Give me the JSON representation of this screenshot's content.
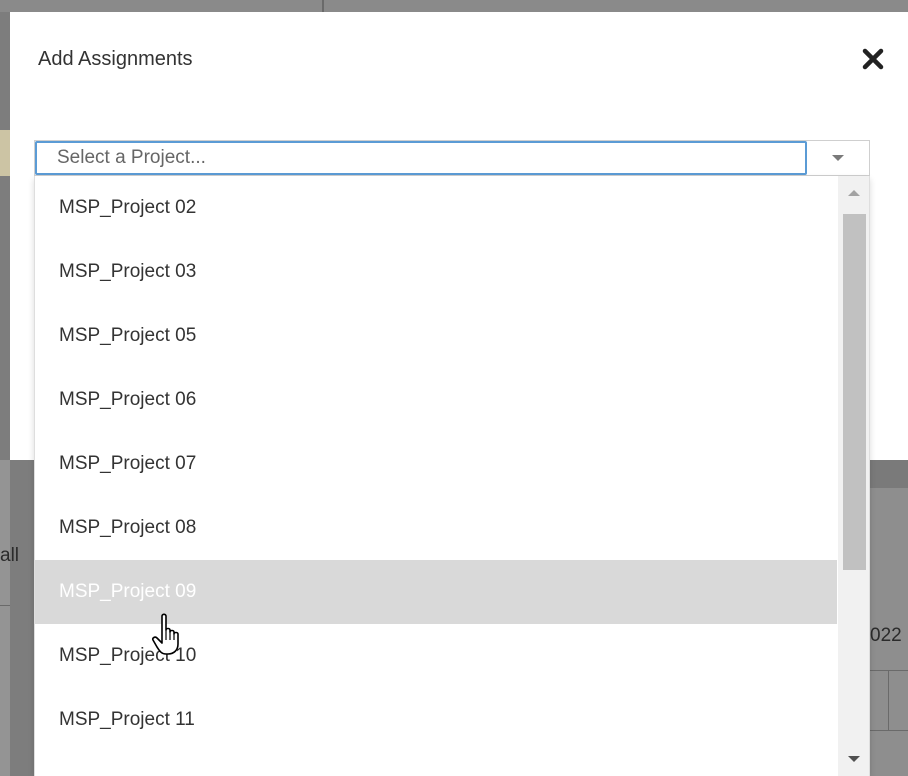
{
  "modal": {
    "title": "Add Assignments",
    "close_icon": "close-icon"
  },
  "project_select": {
    "placeholder": "Select a Project...",
    "value": "",
    "arrow_icon": "chevron-down-icon"
  },
  "dropdown": {
    "items": [
      {
        "label": "MSP_Project 02"
      },
      {
        "label": "MSP_Project 03"
      },
      {
        "label": "MSP_Project 05"
      },
      {
        "label": "MSP_Project 06"
      },
      {
        "label": "MSP_Project 07"
      },
      {
        "label": "MSP_Project 08"
      },
      {
        "label": "MSP_Project 09"
      },
      {
        "label": "MSP_Project 10"
      },
      {
        "label": "MSP_Project 11"
      }
    ],
    "hovered_label": "MSP_Project 09"
  },
  "background": {
    "left_text": "all",
    "right_text": "022"
  },
  "colors": {
    "focus_border": "#5b9bd5",
    "hover_row": "#d9d9d9",
    "overlay": "#7d7d7d"
  }
}
